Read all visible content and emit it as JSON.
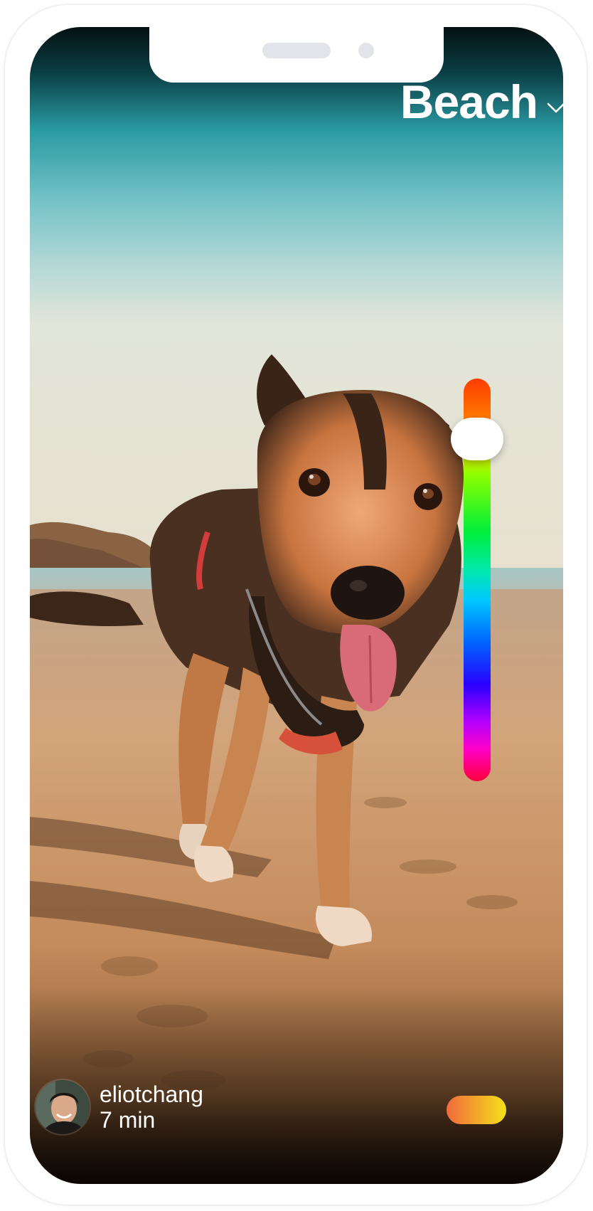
{
  "screen": {
    "title": "Beach",
    "title_icon": "chevron-down-icon",
    "slider": {
      "value_from_top": 0.15
    },
    "author": {
      "username": "eliotchang",
      "time_ago": "7 min"
    }
  },
  "colors": {
    "title_text": "#ffffff",
    "pill_start": "#f26a3c",
    "pill_end": "#f2e21a"
  }
}
